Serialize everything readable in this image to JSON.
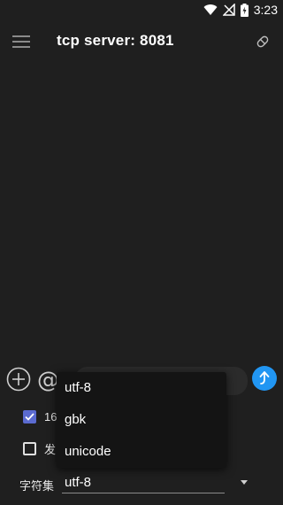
{
  "status_bar": {
    "time": "3:23",
    "icons": [
      "wifi-icon",
      "signal-off-icon",
      "battery-charging-icon"
    ]
  },
  "app_bar": {
    "title": "tcp server: 8081",
    "menu_icon": "menu-icon",
    "action_icon": "disconnect-icon"
  },
  "input_row": {
    "add_icon": "add-circle-icon",
    "at_icon": "at-icon",
    "message_value": "",
    "send_icon": "send-icon"
  },
  "options": {
    "hex_label": "16",
    "hex_checked": true,
    "send_label": "发",
    "send_checked": false
  },
  "charset": {
    "label": "字符集",
    "selected": "utf-8"
  },
  "dropdown": {
    "items": [
      "utf-8",
      "gbk",
      "unicode"
    ]
  },
  "colors": {
    "background": "#1f1f1f",
    "accent": "#2196f3",
    "checkbox": "#5b6bd0"
  }
}
